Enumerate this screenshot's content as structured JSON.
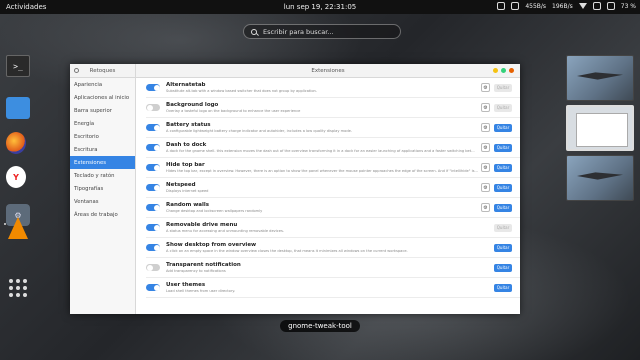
{
  "topbar": {
    "activities": "Actividades",
    "clock": "lun sep 19, 22:31:05",
    "net_down": "455B/s",
    "net_up": "196B/s",
    "battery": "73 %"
  },
  "search": {
    "placeholder": "Escribir para buscar..."
  },
  "window": {
    "sidebar_header": "Retoques",
    "title": "Extensiones",
    "sidebar": [
      {
        "label": "Apariencia",
        "selected": false
      },
      {
        "label": "Aplicaciones al inicio",
        "selected": false
      },
      {
        "label": "Barra superior",
        "selected": false
      },
      {
        "label": "Energía",
        "selected": false
      },
      {
        "label": "Escritorio",
        "selected": false
      },
      {
        "label": "Escritura",
        "selected": false
      },
      {
        "label": "Extensiones",
        "selected": true
      },
      {
        "label": "Teclado y ratón",
        "selected": false
      },
      {
        "label": "Tipografías",
        "selected": false
      },
      {
        "label": "Ventanas",
        "selected": false
      },
      {
        "label": "Áreas de trabajo",
        "selected": false
      }
    ],
    "extensions": [
      {
        "name": "Alternatetab",
        "desc": "Substitute alt-tab with a window based switcher that does not group by application.",
        "on": true,
        "gear": true,
        "remove": "Quitar",
        "remove_enabled": false
      },
      {
        "name": "Background logo",
        "desc": "Overlay a tasteful logo on the background to enhance the user experience",
        "on": false,
        "gear": true,
        "remove": "Quitar",
        "remove_enabled": false
      },
      {
        "name": "Battery status",
        "desc": "A configurable lightweight battery charge indicator and autohider, includes a low quality display mode.",
        "on": true,
        "gear": true,
        "remove": "Quitar",
        "remove_enabled": true
      },
      {
        "name": "Dash to dock",
        "desc": "A dock for the gnome shell. this extension moves the dash out of the overview transforming it in a dock for an easier launching of applications and a faster switching bet...",
        "on": true,
        "gear": true,
        "remove": "Quitar",
        "remove_enabled": true
      },
      {
        "name": "Hide top bar",
        "desc": "Hides the top bar, except in overview. However, there is an option to show the panel whenever the mouse pointer approaches the edge of the screen. And if \"intellihide\" is...",
        "on": true,
        "gear": true,
        "remove": "Quitar",
        "remove_enabled": true
      },
      {
        "name": "Netspeed",
        "desc": "Displays internet speed",
        "on": true,
        "gear": true,
        "remove": "Quitar",
        "remove_enabled": true
      },
      {
        "name": "Random walls",
        "desc": "Change desktop and lockscreen wallpapers randomly",
        "on": true,
        "gear": true,
        "remove": "Quitar",
        "remove_enabled": true
      },
      {
        "name": "Removable drive menu",
        "desc": "A status menu for accessing and unmounting removable devices.",
        "on": true,
        "gear": false,
        "remove": "Quitar",
        "remove_enabled": false
      },
      {
        "name": "Show desktop from overview",
        "desc": "A click on an empty space in the window overview closes the desktop, that means it minimizes all windows on the current workspace.",
        "on": true,
        "gear": false,
        "remove": "Quitar",
        "remove_enabled": true
      },
      {
        "name": "Transparent notification",
        "desc": "Add transparency to notifications",
        "on": false,
        "gear": false,
        "remove": "Quitar",
        "remove_enabled": true
      },
      {
        "name": "User themes",
        "desc": "Load shell themes from user directory.",
        "on": true,
        "gear": false,
        "remove": "Quitar",
        "remove_enabled": true
      }
    ]
  },
  "caption": "gnome-tweak-tool",
  "dash": {
    "terminal_glyph": ">_",
    "yandex_glyph": "Y",
    "settings_glyph": "⚙"
  },
  "colors": {
    "accent": "#3584e4"
  }
}
